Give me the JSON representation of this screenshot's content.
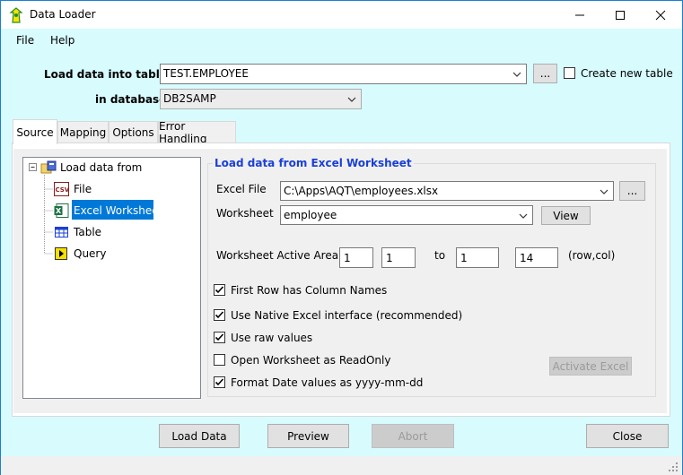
{
  "window": {
    "title": "Data Loader"
  },
  "menu": {
    "file": "File",
    "help": "Help"
  },
  "target": {
    "table_label": "Load data into table",
    "table_value": "TEST.EMPLOYEE",
    "browse_label": "...",
    "create_new_label": "Create new table",
    "create_new_checked": false,
    "database_label": "in database",
    "database_value": "DB2SAMP"
  },
  "tabs": [
    {
      "label": "Source",
      "active": true
    },
    {
      "label": "Mapping",
      "active": false
    },
    {
      "label": "Options",
      "active": false
    },
    {
      "label": "Error Handling",
      "active": false
    }
  ],
  "tree": {
    "root": "Load data from",
    "items": [
      {
        "label": "File",
        "icon": "csv-icon",
        "selected": false
      },
      {
        "label": "Excel Worksheet",
        "icon": "excel-icon",
        "selected": true
      },
      {
        "label": "Table",
        "icon": "table-icon",
        "selected": false
      },
      {
        "label": "Query",
        "icon": "query-icon",
        "selected": false
      }
    ]
  },
  "excel": {
    "group_title": "Load data from Excel Worksheet",
    "file_label": "Excel File",
    "file_value": "C:\\Apps\\AQT\\employees.xlsx",
    "file_browse": "...",
    "worksheet_label": "Worksheet",
    "worksheet_value": "employee",
    "view_button": "View",
    "active_area_label": "Worksheet Active Area",
    "from_row": "1",
    "from_col": "1",
    "to_label": "to",
    "to_row": "1",
    "to_col": "14",
    "rowcol_label": "(row,col)",
    "options": [
      {
        "label": "First Row has Column Names",
        "checked": true
      },
      {
        "label": "Use Native Excel interface (recommended)",
        "checked": true
      },
      {
        "label": "Use raw values",
        "checked": true
      },
      {
        "label": "Open Worksheet as ReadOnly",
        "checked": false
      },
      {
        "label": "Format Date values as yyyy-mm-dd",
        "checked": true
      }
    ],
    "activate_button": "Activate Excel"
  },
  "footer": {
    "load_data": "Load Data",
    "preview": "Preview",
    "abort": "Abort",
    "close": "Close"
  },
  "colors": {
    "accent": "#1a7fd6",
    "background": "#d8fbfe",
    "selection": "#0078d7",
    "group_title": "#1a3fd6"
  }
}
